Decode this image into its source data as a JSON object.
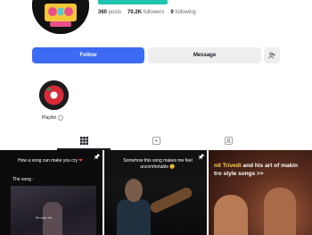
{
  "profile": {
    "stats": {
      "posts_value": "360",
      "posts_label": "posts",
      "followers_value": "70.2K",
      "followers_label": "followers",
      "following_value": "9",
      "following_label": "following"
    },
    "accent_color": "#20c5b2"
  },
  "actions": {
    "follow_label": "Follow",
    "message_label": "Message",
    "add_user_icon": "add-user-icon"
  },
  "playlist": {
    "label": "Playlist",
    "count_icon": "info-circle-icon"
  },
  "tabs": [
    {
      "icon": "grid-icon",
      "active": true
    },
    {
      "icon": "repost-icon",
      "active": false
    },
    {
      "icon": "liked-icon",
      "active": false
    }
  ],
  "videos": [
    {
      "caption_line1": "How a song can make you cry",
      "caption_line2": "The song -",
      "inner_text": "Re main Ho",
      "pinned": true
    },
    {
      "caption_line1": "Somehow this song makes me feel",
      "caption_line2": "uncomfortable 😊",
      "pinned": true
    },
    {
      "title_line1_a": "nit Trivedi",
      "title_line1_b": " and his art of makin",
      "title_line2": "tro style songs >>",
      "pinned": false
    }
  ],
  "colors": {
    "follow_button": "#3d6af2",
    "secondary_button": "#eeeeef",
    "highlight_text": "#ffd34d"
  }
}
